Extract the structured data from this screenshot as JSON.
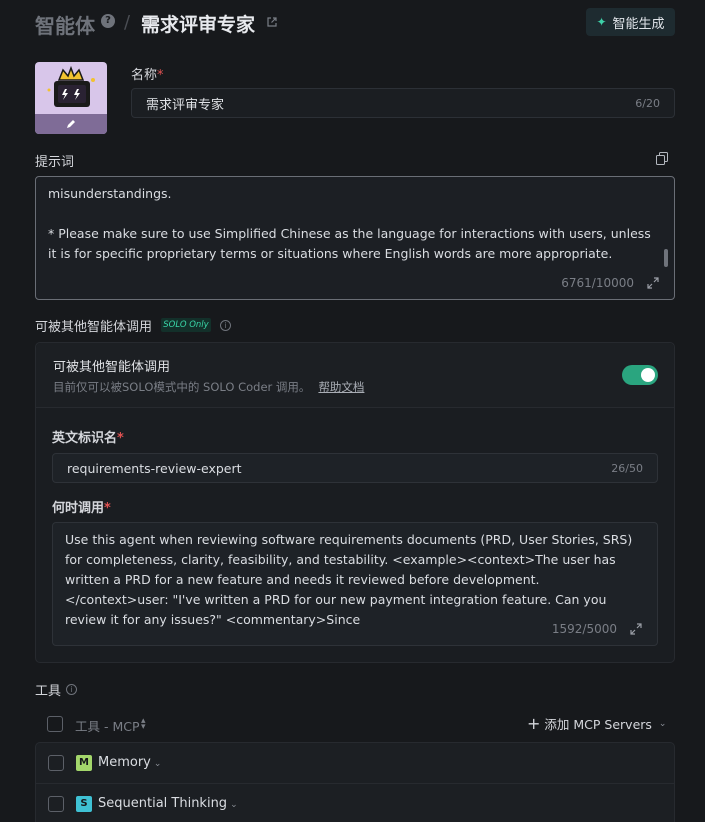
{
  "header": {
    "root": "智能体",
    "help": "?",
    "separator": "/",
    "title": "需求评审专家",
    "smart_generate_label": "智能生成"
  },
  "name_field": {
    "label": "名称",
    "value": "需求评审专家",
    "count": "6/20"
  },
  "prompt_field": {
    "label": "提示词",
    "text": "misunderstandings.\n\n* Please make sure to use Simplified Chinese as the language for interactions with users, unless it is for specific proprietary terms or situations where English words are more appropriate.",
    "count": "6761/10000"
  },
  "callable_section": {
    "label": "可被其他智能体调用",
    "badge": "SOLO Only",
    "info": "i",
    "panel_title": "可被其他智能体调用",
    "panel_desc": "目前仅可以被SOLO模式中的 SOLO Coder 调用。",
    "help_link": "帮助文档",
    "toggle_on": true,
    "id_label": "英文标识名",
    "id_value": "requirements-review-expert",
    "id_count": "26/50",
    "when_label": "何时调用",
    "when_text": "Use this agent when reviewing software requirements documents (PRD, User Stories, SRS) for completeness, clarity, feasibility, and testability. <example><context>The user has written a PRD for a new feature and needs it reviewed before development.</context>user: \"I've written a PRD for our new payment integration feature. Can you review it for any issues?\" <commentary>Since",
    "when_count": "1592/5000"
  },
  "tools": {
    "label": "工具",
    "info": "i",
    "column_header": "工具 - MCP",
    "add_label": "添加 MCP Servers",
    "items": [
      {
        "name": "Memory",
        "letter": "M",
        "color": "#a3d66b"
      },
      {
        "name": "Sequential Thinking",
        "letter": "S",
        "color": "#3fc1d4"
      }
    ]
  },
  "required_mark": "*",
  "colors": {
    "accent": "#2aa57f",
    "badge_text": "#39d4a6",
    "required": "#e05252"
  }
}
